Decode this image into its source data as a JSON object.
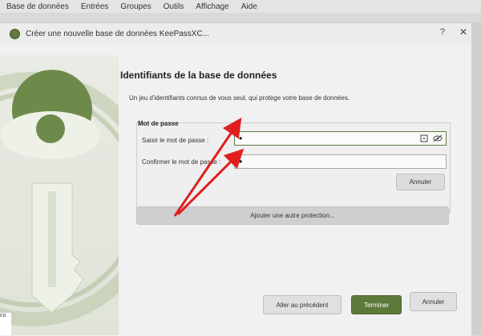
{
  "menubar": {
    "items": [
      "Base de données",
      "Entrées",
      "Groupes",
      "Outils",
      "Affichage",
      "Aide"
    ]
  },
  "dialog": {
    "title": "Créer une nouvelle base de données KeePassXC...",
    "help": "?",
    "close": "✕"
  },
  "content": {
    "heading": "Identifiants de la base de données",
    "subtitle": "Un jeu d'identifiants connus de vous seul, qui protège votre base de données.",
    "group_title": "Mot de passe",
    "enter_label": "Saisir le mot de passe :",
    "enter_value": "•",
    "confirm_label": "Confirmer le mot de passe :",
    "confirm_value": "•",
    "cancel_pw_button": "Annuler",
    "add_protection_button": "Ajouter une autre protection..."
  },
  "footer": {
    "back_button": "Aller au précédent",
    "finish_button": "Terminer",
    "cancel_button": "Annuler"
  },
  "colors": {
    "accent": "#5d7a3b",
    "arrow": "#e01e1e",
    "logo_green": "#6e8a4a"
  },
  "icons": {
    "generate": "dice-icon",
    "reveal": "eye-slash-icon"
  },
  "bottom_left_text": "co"
}
